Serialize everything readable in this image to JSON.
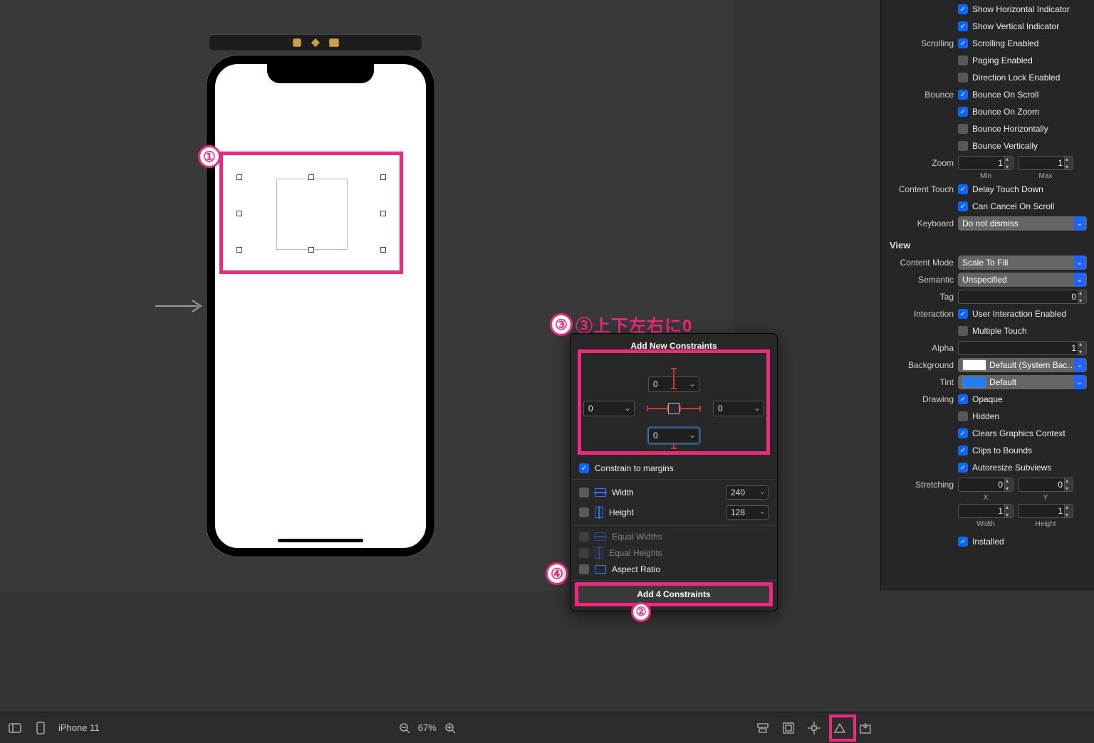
{
  "annotations": {
    "step3_label": "③上下左右に0"
  },
  "bottombar": {
    "device": "iPhone 11",
    "zoom": "67%"
  },
  "popover": {
    "title": "Add New Constraints",
    "top": "0",
    "left": "0",
    "right": "0",
    "bottom": "0",
    "constrain_margins_label": "Constrain to margins",
    "constrain_margins_checked": "✓",
    "width_label": "Width",
    "width_value": "240",
    "height_label": "Height",
    "height_value": "128",
    "equal_widths": "Equal Widths",
    "equal_heights": "Equal Heights",
    "aspect_ratio": "Aspect Ratio",
    "add_button": "Add 4 Constraints"
  },
  "inspector": {
    "indicator": {
      "horiz": "Show Horizontal Indicator",
      "vert": "Show Vertical Indicator"
    },
    "scrolling": {
      "label": "Scrolling",
      "enabled": "Scrolling Enabled",
      "paging": "Paging Enabled",
      "direction_lock": "Direction Lock Enabled"
    },
    "bounce": {
      "label": "Bounce",
      "on_scroll": "Bounce On Scroll",
      "on_zoom": "Bounce On Zoom",
      "horizontally": "Bounce Horizontally",
      "vertically": "Bounce Vertically"
    },
    "zoom": {
      "label": "Zoom",
      "min": "1",
      "max": "1",
      "min_lbl": "Min",
      "max_lbl": "Max"
    },
    "content_touch": {
      "label": "Content Touch",
      "delay": "Delay Touch Down",
      "cancel": "Can Cancel On Scroll"
    },
    "keyboard": {
      "label": "Keyboard",
      "value": "Do not dismiss"
    },
    "view_section": "View",
    "content_mode": {
      "label": "Content Mode",
      "value": "Scale To Fill"
    },
    "semantic": {
      "label": "Semantic",
      "value": "Unspecified"
    },
    "tag": {
      "label": "Tag",
      "value": "0"
    },
    "interaction": {
      "label": "Interaction",
      "user": "User Interaction Enabled",
      "multi": "Multiple Touch"
    },
    "alpha": {
      "label": "Alpha",
      "value": "1"
    },
    "background": {
      "label": "Background",
      "value": "Default (System Bac…"
    },
    "tint": {
      "label": "Tint",
      "value": "Default"
    },
    "drawing": {
      "label": "Drawing",
      "opaque": "Opaque",
      "hidden": "Hidden",
      "clears": "Clears Graphics Context",
      "clips": "Clips to Bounds",
      "autoresize": "Autoresize Subviews"
    },
    "stretching": {
      "label": "Stretching",
      "x": "0",
      "y": "0",
      "xl": "X",
      "yl": "Y",
      "w": "1",
      "h": "1",
      "wl": "Width",
      "hl": "Height"
    },
    "installed": "Installed"
  }
}
